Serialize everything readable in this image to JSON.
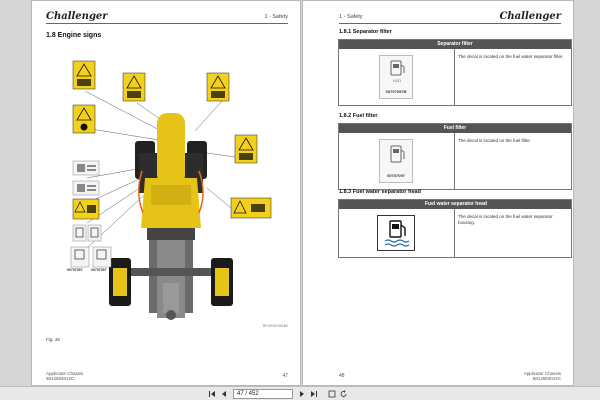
{
  "left_page": {
    "brand": "Challenger",
    "section_header": "1 - Safety",
    "section_title": "1.8    Engine signs",
    "figure_caption": "Fig. 38",
    "figure_ref": "RP22H01001B0",
    "footer_line1": "Applicator Chassis",
    "footer_line2": "5812584012C",
    "page_number": "47",
    "decal_parts": [
      "00707097",
      "00707097"
    ]
  },
  "right_page": {
    "brand": "Challenger",
    "section_header": "1 - Safety",
    "page_number": "48",
    "footer_line1": "Applicator Chassis",
    "footer_line2": "5812584012C",
    "subsections": [
      {
        "title": "1.8.1   Separator filter",
        "table_header": "Separator filter",
        "description": "The decal is located on the fuel water separator filter.",
        "part_number": "00707097B"
      },
      {
        "title": "1.8.2   Fuel filter",
        "table_header": "Fuel filter",
        "description": "The decal is located on the fuel filter.",
        "part_number": "00707097"
      },
      {
        "title": "1.8.3   Fuel water separator head",
        "table_header": "Fuel water separator head",
        "description": "The decal is located on the fuel water separator housing.",
        "part_number": ""
      }
    ]
  },
  "toolbar": {
    "page_field": "47 / 452",
    "icons": [
      "first-page-icon",
      "prev-page-icon",
      "next-page-icon",
      "last-page-icon",
      "fit-page-icon",
      "rotate-icon"
    ]
  },
  "colors": {
    "warning_yellow": "#f2d01c",
    "tractor_yellow": "#e6c317",
    "toolbar_bg": "#e8e8e8",
    "header_gray": "#555555"
  }
}
